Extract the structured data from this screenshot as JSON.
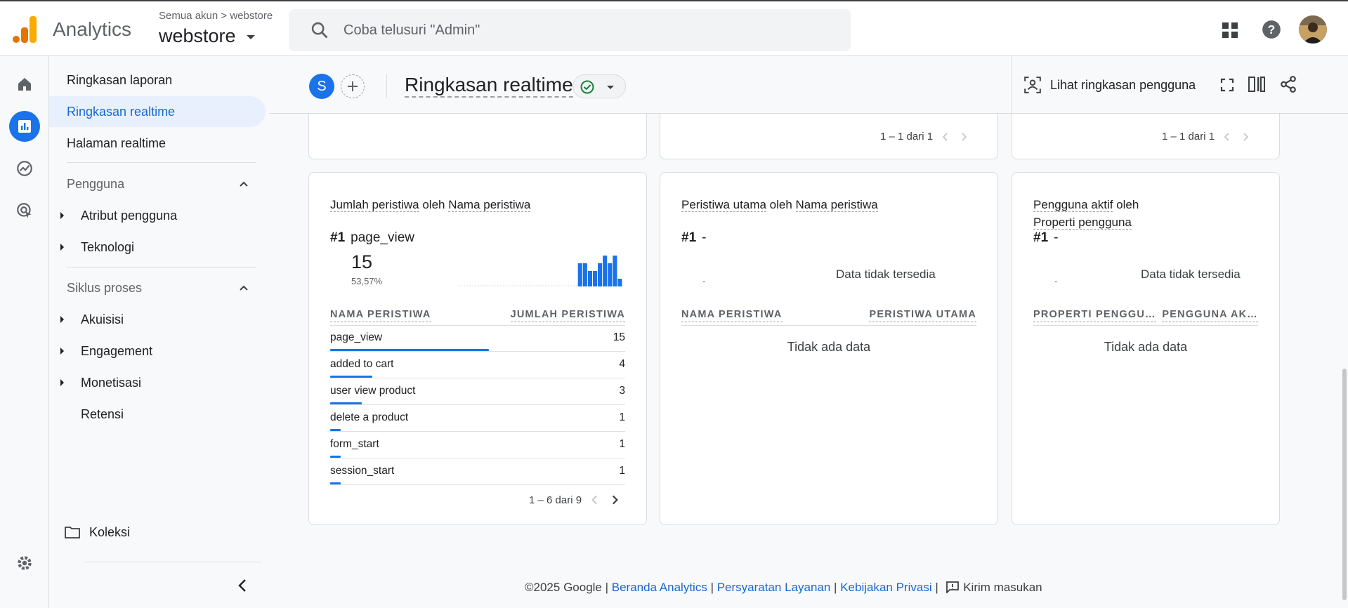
{
  "header": {
    "app_name": "Analytics",
    "breadcrumb": "Semua akun > webstore",
    "property_name": "webstore",
    "search_placeholder": "Coba telusuri \"Admin\""
  },
  "nav": {
    "items_top": [
      {
        "label": "Ringkasan laporan",
        "active": false
      },
      {
        "label": "Ringkasan realtime",
        "active": true
      },
      {
        "label": "Halaman realtime",
        "active": false
      }
    ],
    "section_users": "Pengguna",
    "users_items": [
      "Atribut pengguna",
      "Teknologi"
    ],
    "section_lifecycle": "Siklus proses",
    "lifecycle_items": [
      "Akuisisi",
      "Engagement",
      "Monetisasi"
    ],
    "retention": "Retensi",
    "collections": "Koleksi"
  },
  "subheader": {
    "compare_letter": "S",
    "title": "Ringkasan realtime",
    "user_summary": "Lihat ringkasan pengguna"
  },
  "top_cards": {
    "pager_mid": "1 – 1 dari 1",
    "pager_right": "1 – 1 dari 1"
  },
  "card_events": {
    "title_a": "Jumlah peristiwa",
    "title_mid": " oleh ",
    "title_b": "Nama peristiwa",
    "rank": "#1",
    "rank_value": "page_view",
    "big_value": "15",
    "big_pct": "53,57%",
    "col1": "NAMA PERISTIWA",
    "col2": "JUMLAH PERISTIWA",
    "rows": [
      {
        "label": "page_view",
        "value": "15",
        "fraction": 1.0
      },
      {
        "label": "added to cart",
        "value": "4",
        "fraction": 0.267
      },
      {
        "label": "user view product",
        "value": "3",
        "fraction": 0.2
      },
      {
        "label": "delete a product",
        "value": "1",
        "fraction": 0.067
      },
      {
        "label": "form_start",
        "value": "1",
        "fraction": 0.067
      },
      {
        "label": "session_start",
        "value": "1",
        "fraction": 0.067
      }
    ],
    "pager": "1 – 6 dari 9"
  },
  "card_key_events": {
    "title_a": "Peristiwa utama",
    "title_mid": " oleh ",
    "title_b": "Nama peristiwa",
    "rank": "#1",
    "rank_value": "-",
    "dash": "-",
    "no_data_side": "Data tidak tersedia",
    "col1": "NAMA PERISTIWA",
    "col2": "PERISTIWA UTAMA",
    "no_data": "Tidak ada data"
  },
  "card_active_users": {
    "title_a": "Pengguna aktif",
    "title_mid": " oleh",
    "title_b": "Properti pengguna",
    "rank": "#1",
    "rank_value": "-",
    "dash": "-",
    "no_data_side": "Data tidak tersedia",
    "col1": "PROPERTI PENGGU…",
    "col2": "PENGGUNA AK…",
    "no_data": "Tidak ada data"
  },
  "chart_data": {
    "type": "bar",
    "title": "",
    "values": [
      0,
      0,
      0,
      0,
      0,
      0,
      0,
      0,
      0,
      0,
      0,
      0,
      0,
      0,
      0,
      0,
      0,
      0,
      0,
      0,
      0,
      0,
      0,
      0,
      3,
      3,
      2,
      2,
      3,
      4,
      3,
      4,
      1
    ],
    "xlabel": "",
    "ylabel": ""
  },
  "footer": {
    "copyright": "©2025 Google | ",
    "link1": "Beranda Analytics",
    "sep1": " | ",
    "link2": "Persyaratan Layanan",
    "sep2": " | ",
    "link3": "Kebijakan Privasi",
    "sep3": " | ",
    "feedback": "Kirim masukan"
  },
  "colors": {
    "accent": "#1a73e8",
    "logo_orange": "#f9ab00",
    "logo_dark": "#e37400"
  }
}
